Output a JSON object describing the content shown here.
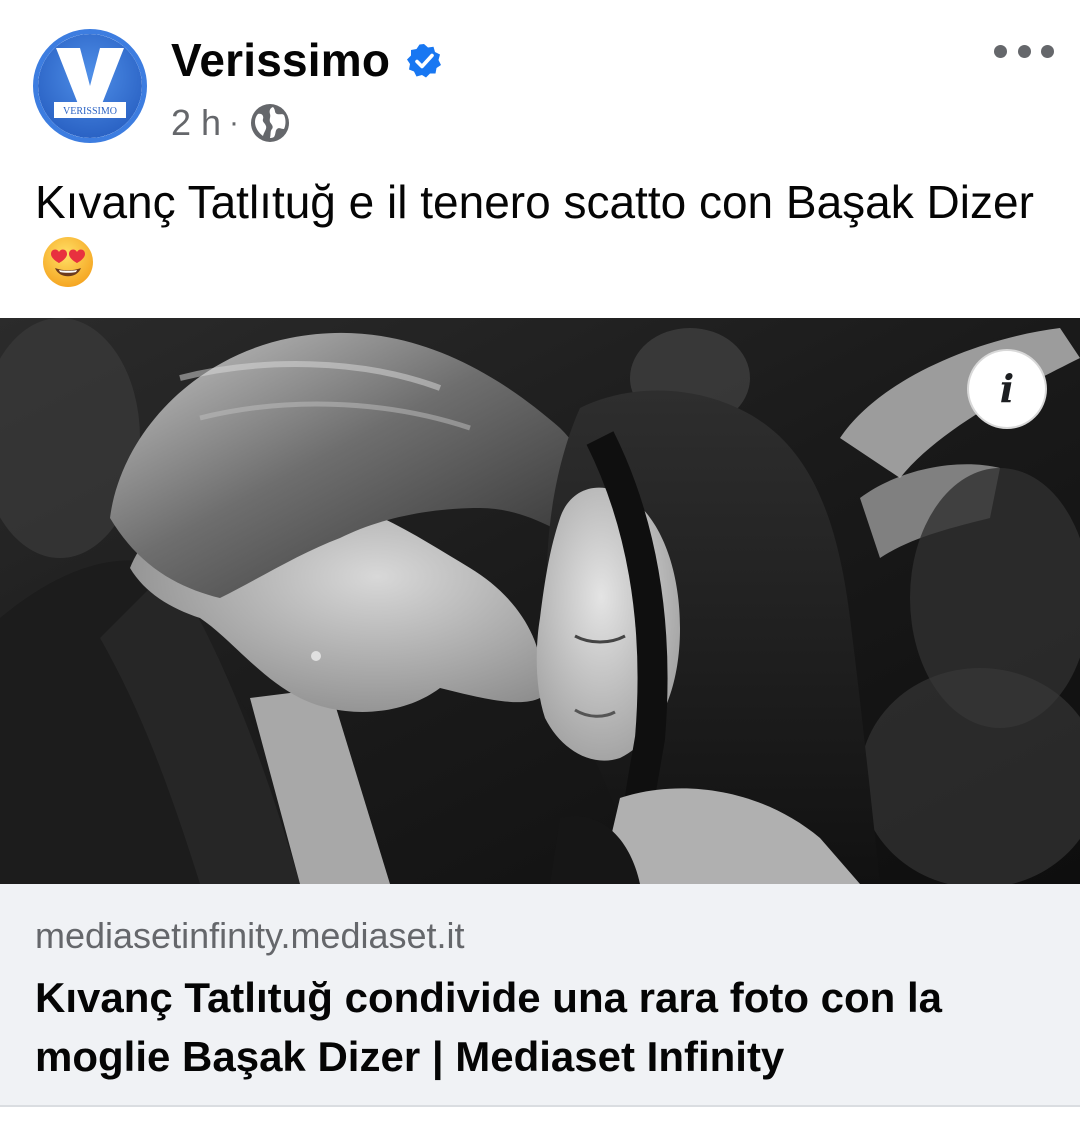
{
  "post": {
    "page_name": "Verissimo",
    "avatar_text": "VERISSIMO",
    "time": "2 h",
    "separator": "·",
    "privacy_icon": "globe-icon",
    "verified_icon": "verified-badge-icon",
    "more_icon": "more-options-icon",
    "text": "Kıvanç Tatlıtuğ e il tenero scatto con Başak Dizer",
    "emoji": "smiling-face-with-heart-eyes-emoji",
    "photo_icon": "info-icon",
    "info_label": "i"
  },
  "link": {
    "domain": "mediasetinfinity.mediaset.it",
    "title": "Kıvanç Tatlıtuğ condivide una rara foto con la moglie Başak Dizer | Mediaset Infinity"
  },
  "colors": {
    "verified_blue": "#1877f2",
    "avatar_ring": "#3d7de0",
    "secondary_text": "#65676b",
    "link_background": "#f0f2f5"
  }
}
